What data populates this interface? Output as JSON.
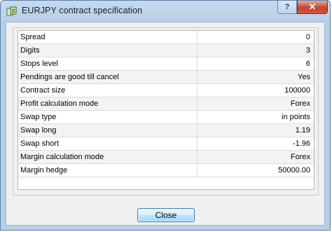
{
  "window": {
    "title": "EURJPY contract specification",
    "help_label": "?",
    "close_glyph": "✕"
  },
  "specs": [
    {
      "label": "Spread",
      "value": "0"
    },
    {
      "label": "Digits",
      "value": "3"
    },
    {
      "label": "Stops level",
      "value": "6"
    },
    {
      "label": "Pendings are good till cancel",
      "value": "Yes"
    },
    {
      "label": "Contract size",
      "value": "100000"
    },
    {
      "label": "Profit calculation mode",
      "value": "Forex"
    },
    {
      "label": "Swap type",
      "value": "in points"
    },
    {
      "label": "Swap long",
      "value": "1.19"
    },
    {
      "label": "Swap short",
      "value": "-1.96"
    },
    {
      "label": "Margin calculation mode",
      "value": "Forex"
    },
    {
      "label": "Margin hedge",
      "value": "50000.00"
    }
  ],
  "footer": {
    "close_label": "Close"
  },
  "colors": {
    "accent": "#3c7fb1",
    "title_bar": "#b8cfe8",
    "window_close": "#c7452e"
  }
}
